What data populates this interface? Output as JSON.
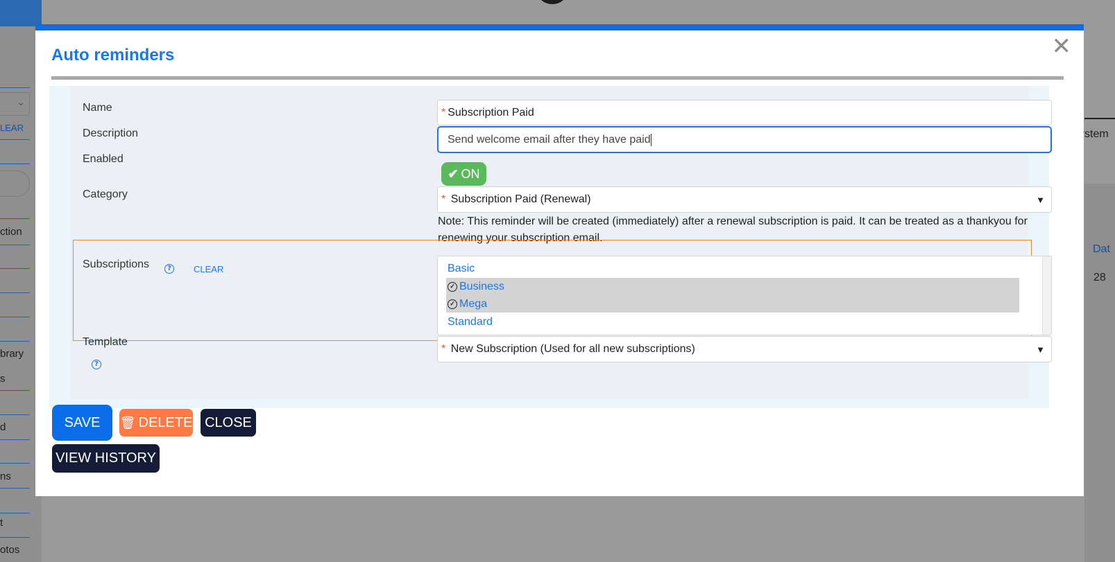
{
  "background": {
    "sidebar_items": [
      "LEAR",
      "ction",
      "brary",
      "s",
      "d",
      "ns",
      "t",
      "otos"
    ],
    "right_texts": [
      "ystem",
      "Dat",
      "28"
    ]
  },
  "modal": {
    "title": "Auto reminders",
    "close_icon": "✕"
  },
  "form": {
    "name": {
      "label": "Name",
      "value": "Subscription Paid",
      "required_mark": "*"
    },
    "description": {
      "label": "Description",
      "value": "Send welcome email after they have paid"
    },
    "enabled": {
      "label": "Enabled",
      "toggle_label": "ON",
      "icon": "check-icon"
    },
    "category": {
      "label": "Category",
      "required_mark": "*",
      "selected": "Subscription Paid (Renewal)",
      "note": "Note: This reminder will be created (immediately) after a renewal subscription is paid. It can be treated as a thankyou for renewing your subscription email."
    },
    "subscriptions": {
      "label": "Subscriptions",
      "clear_label": "CLEAR",
      "options": [
        {
          "label": "Basic",
          "selected": false
        },
        {
          "label": "Business",
          "selected": true
        },
        {
          "label": "Mega",
          "selected": true
        },
        {
          "label": "Standard",
          "selected": false
        }
      ]
    },
    "template": {
      "label": "Template",
      "required_mark": "*",
      "selected": "New Subscription (Used for all new subscriptions)"
    }
  },
  "buttons": {
    "save": "SAVE",
    "delete": "DELETE",
    "close": "CLOSE",
    "view_history": "VIEW HISTORY"
  },
  "colors": {
    "accent": "#0a6ee8",
    "toggle_on": "#5cb85c",
    "delete": "#ff7a45",
    "dark_button": "#141c37"
  }
}
